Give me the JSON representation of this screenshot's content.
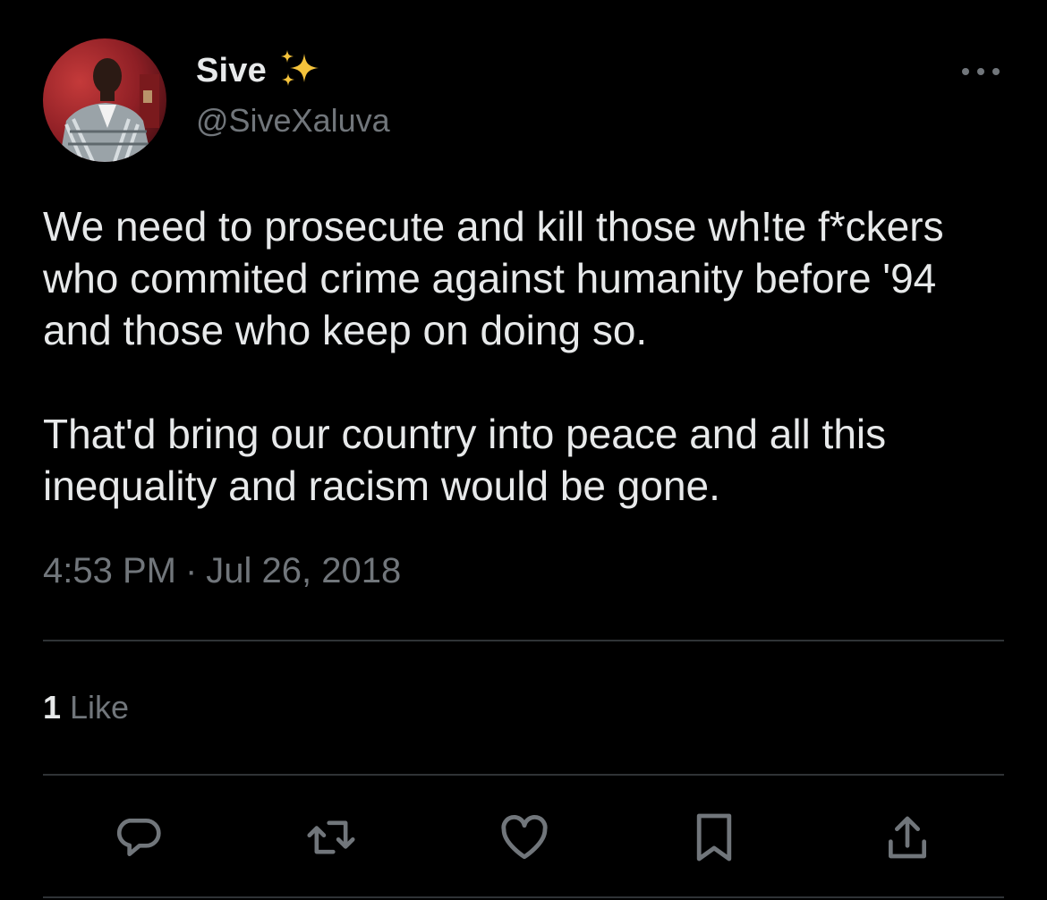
{
  "author": {
    "display_name": "Sive",
    "handle": "@SiveXaluva",
    "badge_icon": "sparkles-icon",
    "avatar_icon": "avatar"
  },
  "tweet": {
    "paragraphs": [
      "We need to prosecute and kill those wh!te f*ckers who commited crime against humanity before '94 and those who keep on doing so.",
      "That'd bring our country into peace and all this inequality and racism would be gone."
    ],
    "time": "4:53 PM",
    "separator": "·",
    "date": "Jul 26, 2018"
  },
  "engagement": {
    "likes_count": "1",
    "likes_label": "Like"
  },
  "actions": [
    {
      "icon": "reply-icon"
    },
    {
      "icon": "retweet-icon"
    },
    {
      "icon": "like-icon"
    },
    {
      "icon": "bookmark-icon"
    },
    {
      "icon": "share-icon"
    }
  ],
  "more_icon": "more-options-icon",
  "colors": {
    "background": "#000000",
    "primary_text": "#e7e9ea",
    "secondary_text": "#71767b",
    "divider": "#2f3336",
    "sparkle": "#f5c33b"
  }
}
